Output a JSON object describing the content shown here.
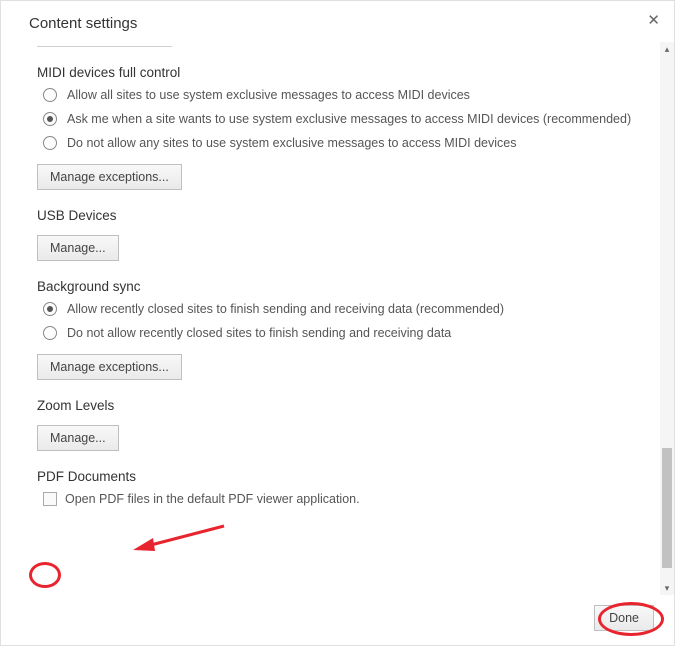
{
  "header": {
    "title": "Content settings"
  },
  "midi": {
    "heading": "MIDI devices full control",
    "opt_allow": "Allow all sites to use system exclusive messages to access MIDI devices",
    "opt_ask": "Ask me when a site wants to use system exclusive messages to access MIDI devices (recommended)",
    "opt_deny": "Do not allow any sites to use system exclusive messages to access MIDI devices",
    "manage": "Manage exceptions..."
  },
  "usb": {
    "heading": "USB Devices",
    "manage": "Manage..."
  },
  "bgsync": {
    "heading": "Background sync",
    "opt_allow": "Allow recently closed sites to finish sending and receiving data (recommended)",
    "opt_deny": "Do not allow recently closed sites to finish sending and receiving data",
    "manage": "Manage exceptions..."
  },
  "zoom": {
    "heading": "Zoom Levels",
    "manage": "Manage..."
  },
  "pdf": {
    "heading": "PDF Documents",
    "opt": "Open PDF files in the default PDF viewer application."
  },
  "footer": {
    "done": "Done"
  }
}
